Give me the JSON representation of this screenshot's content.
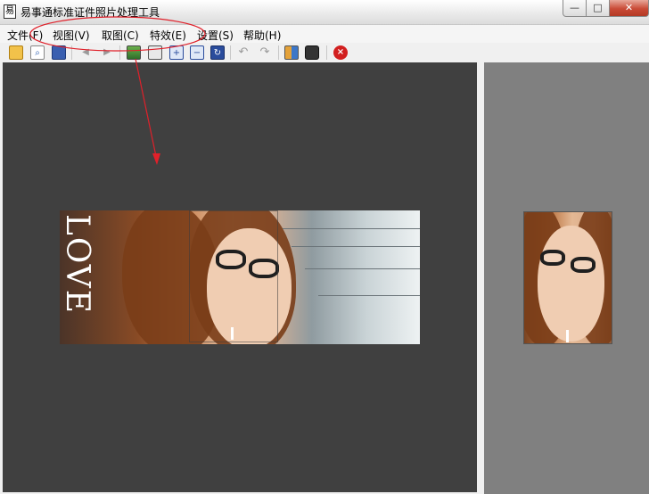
{
  "window": {
    "title": "易事通标准证件照片处理工具",
    "app_icon_glyph": "易",
    "minimize_glyph": "—",
    "maximize_glyph": "□",
    "close_glyph": "✕"
  },
  "menu": {
    "items": [
      {
        "label": "文件(F)"
      },
      {
        "label": "视图(V)"
      },
      {
        "label": "取图(C)"
      },
      {
        "label": "特效(E)"
      },
      {
        "label": "设置(S)"
      },
      {
        "label": "帮助(H)"
      }
    ]
  },
  "toolbar": {
    "icons": [
      "open-folder-icon",
      "preview-icon",
      "save-icon",
      "back-arrow-icon",
      "forward-arrow-icon",
      "image-icon",
      "book-icon",
      "zoom-in-icon",
      "zoom-out-icon",
      "refresh-icon",
      "undo-icon",
      "redo-icon",
      "people-icon",
      "camera-icon",
      "exit-icon"
    ]
  },
  "photo": {
    "overlay_text": "LOVE"
  },
  "colors": {
    "left_panel": "#404040",
    "right_panel": "#808080",
    "annotation": "#e0202a"
  }
}
